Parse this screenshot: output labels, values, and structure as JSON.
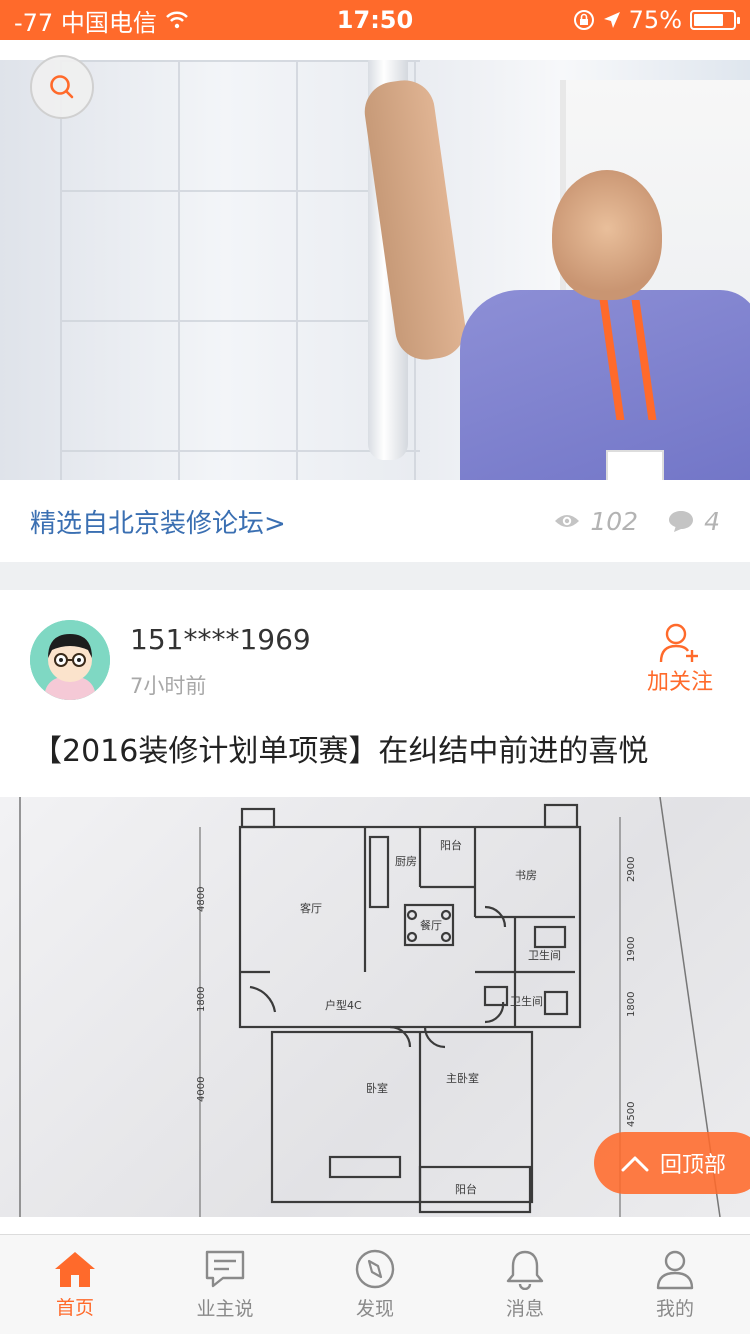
{
  "status_bar": {
    "carrier": "-77 中国电信",
    "time": "17:50",
    "battery_percent": "75%",
    "battery_level": 0.75
  },
  "feed": {
    "source_label": "精选自北京装修论坛>",
    "views": "102",
    "comments": "4",
    "post": {
      "username": "151****1969",
      "time_ago": "7小时前",
      "follow_label": "加关注",
      "title": "【2016装修计划单项赛】在纠结中前进的喜悦"
    },
    "floor_plan_labels": {
      "unit_type": "户型4C",
      "living_room": "客厅",
      "dining": "餐厅",
      "kitchen": "厨房",
      "study": "书房",
      "bathroom": "卫生间",
      "bedroom": "卧室",
      "master_bedroom": "主卧室",
      "balcony_top": "阳台",
      "balcony_bottom": "阳台",
      "dim_2900": "2900",
      "dim_1900": "1900",
      "dim_1800_right": "1800",
      "dim_4500": "4500",
      "dim_4800": "4800",
      "dim_1800_left": "1800",
      "dim_4000": "4000"
    }
  },
  "back_to_top": "回顶部",
  "tabs": [
    {
      "label": "首页",
      "icon": "home-icon",
      "active": true
    },
    {
      "label": "业主说",
      "icon": "chat-icon",
      "active": false
    },
    {
      "label": "发现",
      "icon": "compass-icon",
      "active": false
    },
    {
      "label": "消息",
      "icon": "bell-icon",
      "active": false
    },
    {
      "label": "我的",
      "icon": "person-icon",
      "active": false
    }
  ],
  "colors": {
    "accent": "#ff6a2b",
    "link": "#3a6fb2",
    "muted": "#a8a8a8"
  }
}
